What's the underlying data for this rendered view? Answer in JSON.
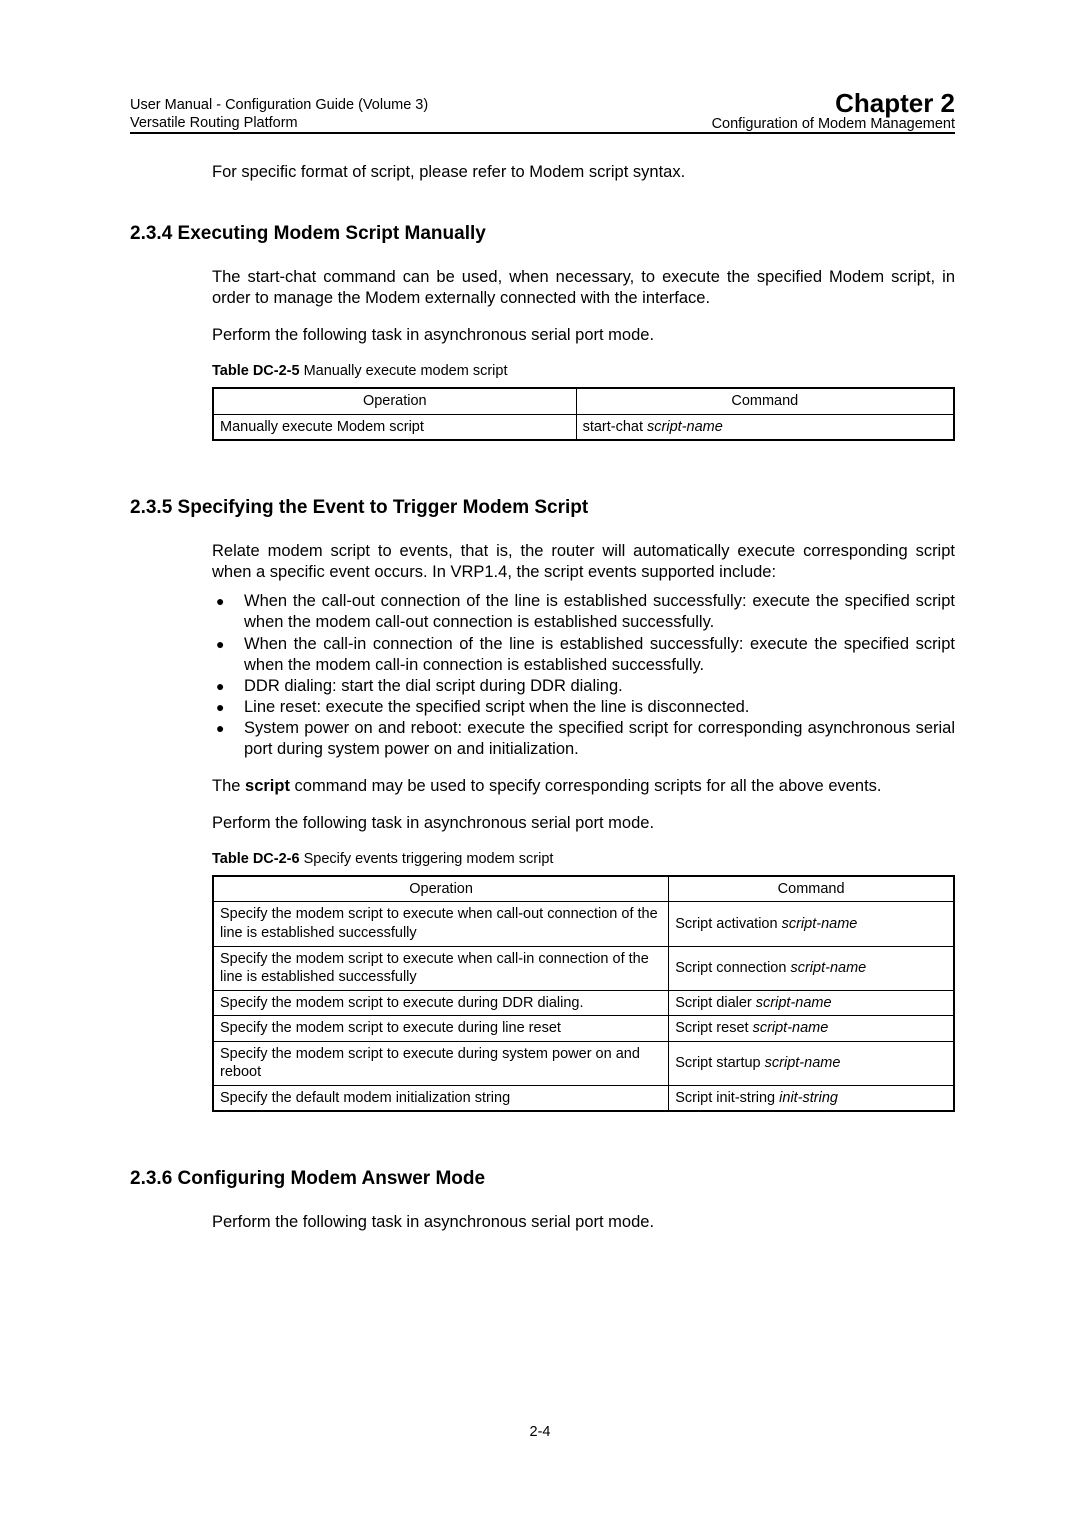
{
  "header": {
    "left_line1": "User Manual - Configuration Guide (Volume 3)",
    "left_line2": "Versatile Routing Platform",
    "chapter": "Chapter 2",
    "sub": "Configuration of Modem Management"
  },
  "intro_line": "For specific format of script, please refer to Modem script syntax.",
  "sec234": {
    "title": "2.3.4  Executing Modem Script Manually",
    "p1": "The start-chat command can be used, when necessary, to execute the specified Modem script, in order to manage the Modem externally connected with the interface.",
    "p2": "Perform the following task in asynchronous serial port mode.",
    "caption_prefix": "Table DC-2-5 ",
    "caption_rest": " Manually execute modem script",
    "columns": {
      "c1": "Operation",
      "c2": "Command"
    },
    "row": {
      "op": "Manually execute Modem script",
      "cmd_pre": "start-chat ",
      "cmd_ital": "script-name"
    }
  },
  "sec235": {
    "title": "2.3.5  Specifying the Event to Trigger Modem Script",
    "p1": "Relate modem script to events, that is, the router will automatically execute corresponding script when a specific event occurs. In VRP1.4, the script events supported include:",
    "bullets": [
      "When the call-out connection of the line is established successfully: execute the specified script when the modem call-out connection is established successfully.",
      "When the call-in connection of the line is established successfully: execute the specified script when the modem call-in connection is established successfully.",
      "DDR dialing: start the dial script during DDR dialing.",
      "Line reset: execute the specified script when the line is disconnected.",
      "System power on and reboot: execute the specified script for corresponding asynchronous serial port during system power on and initialization."
    ],
    "p2_pre": "The ",
    "p2_bold": "script",
    "p2_post": " command may be used to specify corresponding scripts for all the above events.",
    "p3": "Perform the following task in asynchronous serial port mode.",
    "caption_prefix": "Table DC-2-6 ",
    "caption_rest": " Specify events triggering modem script",
    "columns": {
      "c1": "Operation",
      "c2": "Command"
    },
    "rows": [
      {
        "op": "Specify the modem script to execute when call-out connection of the line is established successfully",
        "cmd_pre": "Script activation ",
        "cmd_ital": "script-name"
      },
      {
        "op": "Specify the modem script to execute when call-in connection of the line is established successfully",
        "cmd_pre": "Script connection ",
        "cmd_ital": "script-name"
      },
      {
        "op": "Specify the modem script to execute during DDR dialing.",
        "cmd_pre": "Script dialer ",
        "cmd_ital": "script-name"
      },
      {
        "op": "Specify the modem script to execute during line reset",
        "cmd_pre": "Script reset ",
        "cmd_ital": "script-name"
      },
      {
        "op": "Specify the modem script to execute during system power on and reboot",
        "cmd_pre": "Script startup ",
        "cmd_ital": "script-name"
      },
      {
        "op": "Specify the default modem initialization string",
        "cmd_pre": "Script  init-string  ",
        "cmd_ital": "init-string"
      }
    ]
  },
  "sec236": {
    "title": "2.3.6  Configuring Modem Answer Mode",
    "p1": "Perform the following task in asynchronous serial port mode."
  },
  "footer": "2-4"
}
